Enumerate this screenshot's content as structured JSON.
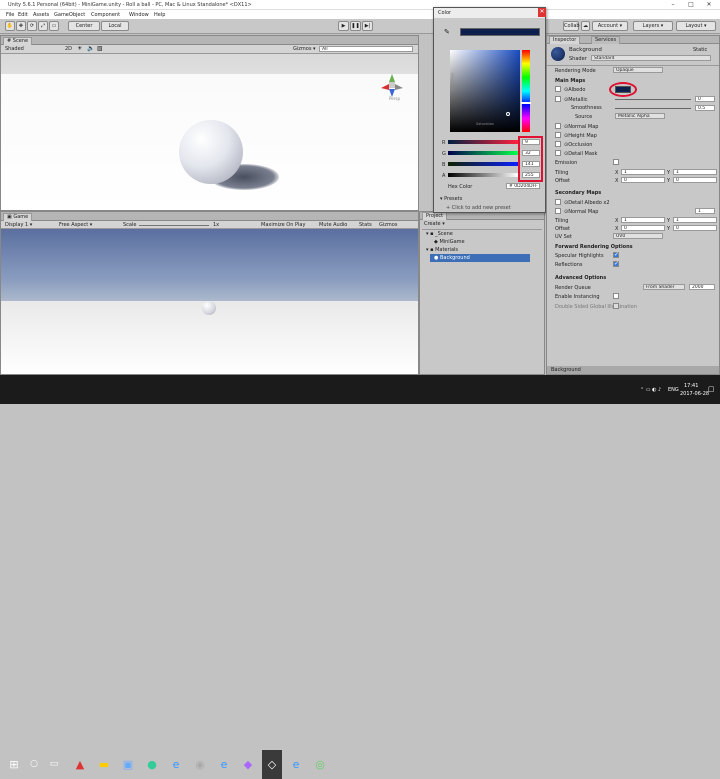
{
  "window": {
    "title": "Unity 5.6.1 Personal (64bit) - MiniGame.unity - Roll a ball - PC, Mac & Linux Standalone* <DX11>"
  },
  "menu": [
    "File",
    "Edit",
    "Assets",
    "GameObject",
    "Component",
    "Window",
    "Help"
  ],
  "toolbar": {
    "center": "Center",
    "local": "Local",
    "collab": "Collab",
    "account": "Account",
    "layers": "Layers",
    "layout": "Layout"
  },
  "scene": {
    "tab": "Scene",
    "shading": "Shaded",
    "mode2d": "2D",
    "gizmos": "Gizmos",
    "search": "All",
    "persp": "Persp"
  },
  "game": {
    "tab": "Game",
    "display": "Display 1",
    "aspect": "Free Aspect",
    "scale_label": "Scale",
    "scale_value": "1x",
    "buttons": [
      "Maximize On Play",
      "Mute Audio",
      "Stats",
      "Gizmos"
    ]
  },
  "project": {
    "tab": "Project",
    "create": "Create",
    "items": [
      "_Scene",
      "MiniGame",
      "Materials",
      "Background"
    ]
  },
  "color": {
    "title": "Color",
    "hex_label": "Hex Color",
    "hex": "0D204DFF",
    "swatch": "#0d204d",
    "channels": [
      {
        "label": "R",
        "value": "9"
      },
      {
        "label": "G",
        "value": "32"
      },
      {
        "label": "B",
        "value": "141"
      },
      {
        "label": "A",
        "value": "255"
      }
    ],
    "presets_label": "Presets",
    "add_preset": "Click to add new preset",
    "saturation_label": "Saturation",
    "brightness_label": "Brightness"
  },
  "inspector": {
    "tabs": [
      "Inspector",
      "Services"
    ],
    "object": "Background",
    "static": "Static",
    "shader_label": "Shader",
    "shader": "Standard",
    "rendering_mode_label": "Rendering Mode",
    "rendering_mode": "Opaque",
    "main_maps": "Main Maps",
    "albedo": "Albedo",
    "metallic": "Metallic",
    "metallic_value": "0",
    "smoothness": "Smoothness",
    "smoothness_value": "0.5",
    "source": "Source",
    "source_value": "Metallic Alpha",
    "normal_map": "Normal Map",
    "height_map": "Height Map",
    "occlusion": "Occlusion",
    "detail_mask": "Detail Mask",
    "emission": "Emission",
    "tiling": "Tiling",
    "offset": "Offset",
    "x": "X",
    "y": "Y",
    "tiling_x": "1",
    "tiling_y": "1",
    "offset_x": "0",
    "offset_y": "0",
    "secondary_maps": "Secondary Maps",
    "detail_albedo": "Detail Albedo x2",
    "sec_normal_map": "Normal Map",
    "sec_normal_value": "1",
    "uv_set": "UV Set",
    "uv_value": "UV0",
    "forward_options": "Forward Rendering Options",
    "specular": "Specular Highlights",
    "reflections": "Reflections",
    "advanced": "Advanced Options",
    "render_queue": "Render Queue",
    "render_queue_mode": "From Shader",
    "render_queue_value": "2000",
    "gpu_instancing": "Enable Instancing",
    "double_gi": "Double Sided Global Illumination",
    "footer": "Background"
  },
  "taskbar": {
    "time": "17:41",
    "date": "2017-06-28",
    "lang": "ENG"
  }
}
